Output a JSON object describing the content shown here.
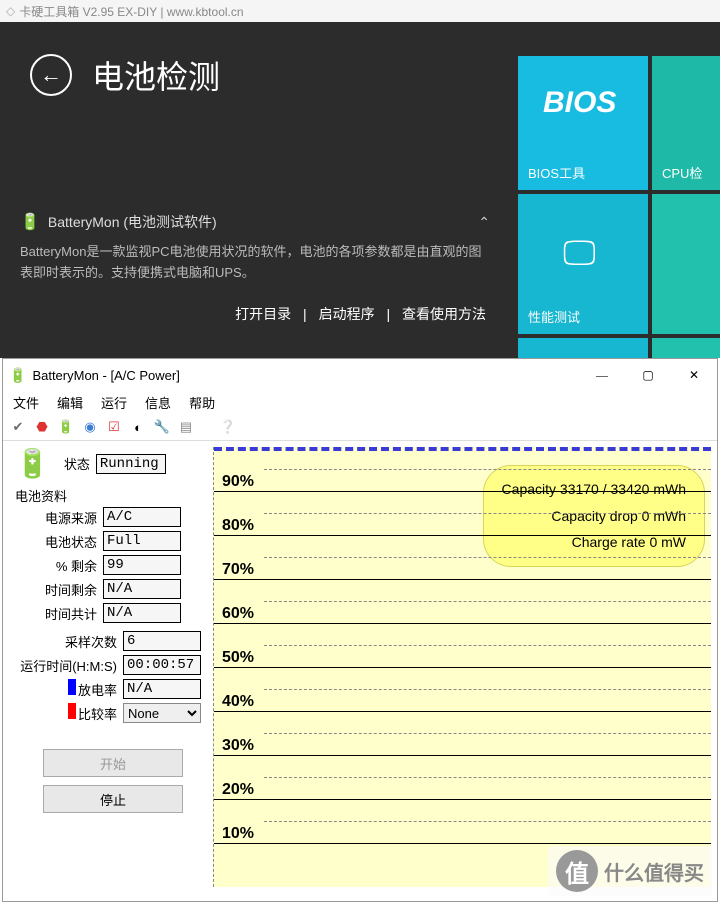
{
  "titlebar": {
    "text": "卡硬工具箱 V2.95  EX-DIY    |   www.kbtool.cn"
  },
  "kbtool": {
    "title": "电池检测",
    "desc_title": "BatteryMon (电池测试软件)",
    "desc_body": "BatteryMon是一款监视PC电池使用状况的软件，电池的各项参数都是由直观的图表即时表示的。支持便携式电脑和UPS。",
    "link_open": "打开目录",
    "link_run": "启动程序",
    "link_help": "查看使用方法",
    "tiles": {
      "bios_big": "BIOS",
      "bios_label": "BIOS工具",
      "cpu_label": "CPU检",
      "perf_label": "性能测试"
    }
  },
  "bm": {
    "title": "BatteryMon - [A/C Power]",
    "menu": {
      "file": "文件",
      "edit": "编辑",
      "run": "运行",
      "info": "信息",
      "help": "帮助"
    },
    "labels": {
      "status": "状态",
      "batt_section": "电池资料",
      "power_src": "电源来源",
      "batt_state": "电池状态",
      "pct_remain": "% 剩余",
      "time_remain": "时间剩余",
      "time_total": "时间共计",
      "samples": "采样次数",
      "runtime": "运行时间(H:M:S)",
      "discharge": "放电率",
      "compare": "比较率"
    },
    "values": {
      "status": "Running",
      "power_src": "A/C",
      "batt_state": "Full",
      "pct_remain": "99",
      "time_remain": "N/A",
      "time_total": "N/A",
      "samples": "6",
      "runtime": "00:00:57",
      "discharge": "N/A",
      "compare": "None"
    },
    "buttons": {
      "start": "开始",
      "stop": "停止"
    },
    "info": {
      "capacity": "Capacity 33170 / 33420 mWh",
      "drop": "Capacity drop 0 mWh",
      "rate": "Charge rate 0 mW"
    },
    "ylabels": [
      "90%",
      "80%",
      "70%",
      "60%",
      "50%",
      "40%",
      "30%",
      "20%",
      "10%"
    ]
  },
  "watermark": "什么值得买"
}
